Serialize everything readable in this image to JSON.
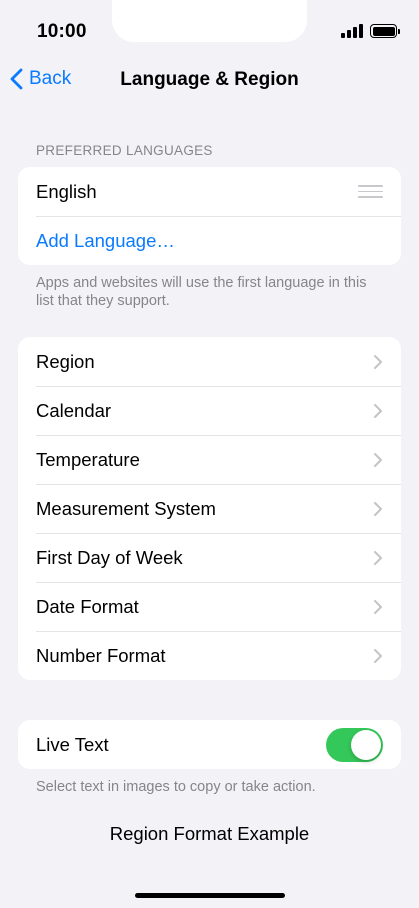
{
  "status": {
    "time": "10:00"
  },
  "nav": {
    "back_label": "Back",
    "title": "Language & Region"
  },
  "preferred_languages": {
    "header": "PREFERRED LANGUAGES",
    "languages": [
      "English"
    ],
    "add_label": "Add Language…",
    "footer": "Apps and websites will use the first language in this list that they support."
  },
  "settings": {
    "items": [
      {
        "label": "Region"
      },
      {
        "label": "Calendar"
      },
      {
        "label": "Temperature"
      },
      {
        "label": "Measurement System"
      },
      {
        "label": "First Day of Week"
      },
      {
        "label": "Date Format"
      },
      {
        "label": "Number Format"
      }
    ]
  },
  "live_text": {
    "label": "Live Text",
    "enabled": true,
    "footer": "Select text in images to copy or take action."
  },
  "region_format": {
    "title": "Region Format Example"
  },
  "colors": {
    "accent": "#0a7aff",
    "toggle_on": "#34c759",
    "background": "#f2f2f7"
  }
}
